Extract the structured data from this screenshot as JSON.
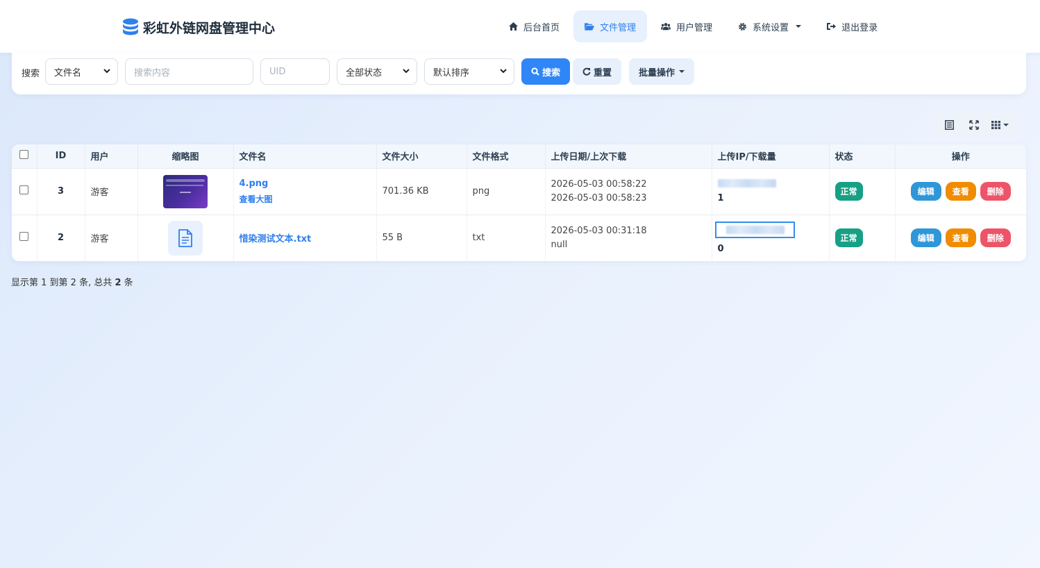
{
  "brand": {
    "title": "彩虹外链网盘管理中心"
  },
  "nav": {
    "items": [
      {
        "label": "后台首页",
        "icon": "home-icon"
      },
      {
        "label": "文件管理",
        "icon": "folder-open-icon",
        "active": true
      },
      {
        "label": "用户管理",
        "icon": "users-icon"
      },
      {
        "label": "系统设置",
        "icon": "gear-icon",
        "dropdown": true
      },
      {
        "label": "退出登录",
        "icon": "sign-out-icon"
      }
    ]
  },
  "filter": {
    "label": "搜索",
    "field_select": "文件名",
    "search_placeholder": "搜索内容",
    "uid_placeholder": "UID",
    "status_select": "全部状态",
    "sort_select": "默认排序",
    "search_button": "搜索",
    "reset_button": "重置",
    "batch_button": "批量操作"
  },
  "table": {
    "headers": [
      "ID",
      "用户",
      "缩略图",
      "文件名",
      "文件大小",
      "文件格式",
      "上传日期/上次下载",
      "上传IP/下载量",
      "状态",
      "操作"
    ],
    "rows": [
      {
        "id": "3",
        "user": "游客",
        "filename": "4.png",
        "preview_link": "查看大图",
        "size": "701.36 KB",
        "format": "png",
        "upload_date": "2026-05-03 00:58:22",
        "last_download": "2026-05-03 00:58:23",
        "downloads": "1",
        "status": "正常"
      },
      {
        "id": "2",
        "user": "游客",
        "filename": "惜染测试文本.txt",
        "preview_link": "",
        "size": "55 B",
        "format": "txt",
        "upload_date": "2026-05-03 00:31:18",
        "last_download": "null",
        "downloads": "0",
        "status": "正常"
      }
    ],
    "actions": {
      "edit": "编辑",
      "view": "查看",
      "delete": "删除"
    }
  },
  "pager": {
    "prefix": "显示第 1 到第 2 条, 总共 ",
    "total": "2",
    "suffix": " 条"
  },
  "colors": {
    "accent": "#2f86f6",
    "status_ok": "#16a085",
    "edit": "#2f97d8",
    "view": "#f08c00",
    "delete": "#ee5468"
  }
}
